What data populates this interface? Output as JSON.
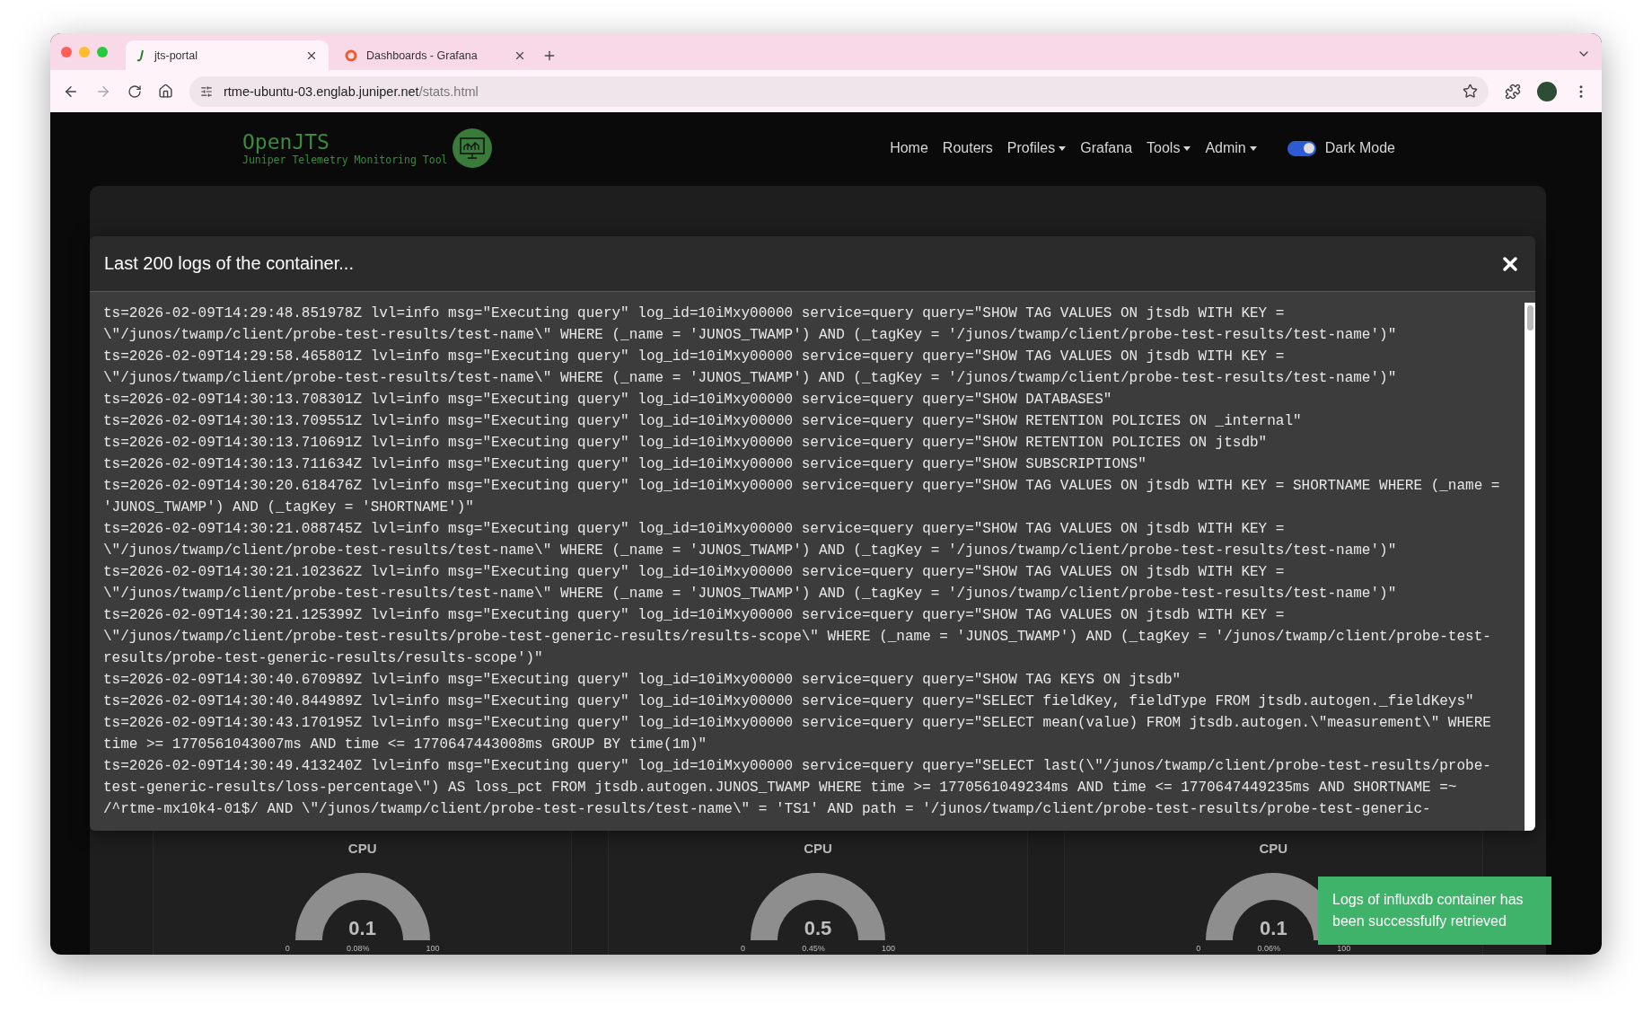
{
  "browser": {
    "tabs": [
      {
        "title": "jts-portal",
        "kind": "hook",
        "selected": true
      },
      {
        "title": "Dashboards - Grafana",
        "kind": "swirl",
        "selected": false
      }
    ],
    "url": {
      "host": "rtme-ubuntu-03.englab.juniper.net",
      "path": "/stats.html"
    },
    "forward_disabled": true
  },
  "navbar": {
    "brand": {
      "title": "OpenJTS",
      "subtitle": "Juniper Telemetry Monitoring Tool"
    },
    "links": [
      {
        "label": "Home",
        "dropdown": false
      },
      {
        "label": "Routers",
        "dropdown": false
      },
      {
        "label": "Profiles",
        "dropdown": true
      },
      {
        "label": "Grafana",
        "dropdown": false
      },
      {
        "label": "Tools",
        "dropdown": true
      },
      {
        "label": "Admin",
        "dropdown": true
      }
    ],
    "dark_mode": {
      "label": "Dark Mode",
      "on": true
    }
  },
  "modal": {
    "title": "Last 200 logs of the container...",
    "logs": [
      "ts=2026-02-09T14:29:48.851978Z lvl=info msg=\"Executing query\" log_id=10iMxy00000 service=query query=\"SHOW TAG VALUES ON jtsdb WITH KEY = \\\"/junos/twamp/client/probe-test-results/test-name\\\" WHERE (_name = 'JUNOS_TWAMP') AND (_tagKey = '/junos/twamp/client/probe-test-results/test-name')\"",
      "ts=2026-02-09T14:29:58.465801Z lvl=info msg=\"Executing query\" log_id=10iMxy00000 service=query query=\"SHOW TAG VALUES ON jtsdb WITH KEY = \\\"/junos/twamp/client/probe-test-results/test-name\\\" WHERE (_name = 'JUNOS_TWAMP') AND (_tagKey = '/junos/twamp/client/probe-test-results/test-name')\"",
      "ts=2026-02-09T14:30:13.708301Z lvl=info msg=\"Executing query\" log_id=10iMxy00000 service=query query=\"SHOW DATABASES\"",
      "ts=2026-02-09T14:30:13.709551Z lvl=info msg=\"Executing query\" log_id=10iMxy00000 service=query query=\"SHOW RETENTION POLICIES ON _internal\"",
      "ts=2026-02-09T14:30:13.710691Z lvl=info msg=\"Executing query\" log_id=10iMxy00000 service=query query=\"SHOW RETENTION POLICIES ON jtsdb\"",
      "ts=2026-02-09T14:30:13.711634Z lvl=info msg=\"Executing query\" log_id=10iMxy00000 service=query query=\"SHOW SUBSCRIPTIONS\"",
      "ts=2026-02-09T14:30:20.618476Z lvl=info msg=\"Executing query\" log_id=10iMxy00000 service=query query=\"SHOW TAG VALUES ON jtsdb WITH KEY = SHORTNAME WHERE (_name = 'JUNOS_TWAMP') AND (_tagKey = 'SHORTNAME')\"",
      "ts=2026-02-09T14:30:21.088745Z lvl=info msg=\"Executing query\" log_id=10iMxy00000 service=query query=\"SHOW TAG VALUES ON jtsdb WITH KEY = \\\"/junos/twamp/client/probe-test-results/test-name\\\" WHERE (_name = 'JUNOS_TWAMP') AND (_tagKey = '/junos/twamp/client/probe-test-results/test-name')\"",
      "ts=2026-02-09T14:30:21.102362Z lvl=info msg=\"Executing query\" log_id=10iMxy00000 service=query query=\"SHOW TAG VALUES ON jtsdb WITH KEY = \\\"/junos/twamp/client/probe-test-results/test-name\\\" WHERE (_name = 'JUNOS_TWAMP') AND (_tagKey = '/junos/twamp/client/probe-test-results/test-name')\"",
      "ts=2026-02-09T14:30:21.125399Z lvl=info msg=\"Executing query\" log_id=10iMxy00000 service=query query=\"SHOW TAG VALUES ON jtsdb WITH KEY = \\\"/junos/twamp/client/probe-test-results/probe-test-generic-results/results-scope\\\" WHERE (_name = 'JUNOS_TWAMP') AND (_tagKey = '/junos/twamp/client/probe-test-results/probe-test-generic-results/results-scope')\"",
      "ts=2026-02-09T14:30:40.670989Z lvl=info msg=\"Executing query\" log_id=10iMxy00000 service=query query=\"SHOW TAG KEYS ON jtsdb\"",
      "ts=2026-02-09T14:30:40.844989Z lvl=info msg=\"Executing query\" log_id=10iMxy00000 service=query query=\"SELECT fieldKey, fieldType FROM jtsdb.autogen._fieldKeys\"",
      "ts=2026-02-09T14:30:43.170195Z lvl=info msg=\"Executing query\" log_id=10iMxy00000 service=query query=\"SELECT mean(value) FROM jtsdb.autogen.\\\"measurement\\\" WHERE time >= 1770561043007ms AND time <= 1770647443008ms GROUP BY time(1m)\"",
      "ts=2026-02-09T14:30:49.413240Z lvl=info msg=\"Executing query\" log_id=10iMxy00000 service=query query=\"SELECT last(\\\"/junos/twamp/client/probe-test-results/probe-test-generic-results/loss-percentage\\\") AS loss_pct FROM jtsdb.autogen.JUNOS_TWAMP WHERE time >= 1770561049234ms AND time <= 1770647449235ms AND SHORTNAME =~ /^rtme-mx10k4-01$/ AND \\\"/junos/twamp/client/probe-test-results/test-name\\\" = 'TS1' AND path = '/junos/twamp/client/probe-test-results/probe-test-generic-"
    ]
  },
  "gauges": [
    {
      "title": "CPU",
      "value": "0.1",
      "min": "0",
      "percent": "0.08%",
      "max": "100"
    },
    {
      "title": "CPU",
      "value": "0.5",
      "min": "0",
      "percent": "0.45%",
      "max": "100"
    },
    {
      "title": "CPU",
      "value": "0.1",
      "min": "0",
      "percent": "0.06%",
      "max": "100"
    }
  ],
  "toast": {
    "message": "Logs of influxdb container has been successfulfy retrieved"
  }
}
